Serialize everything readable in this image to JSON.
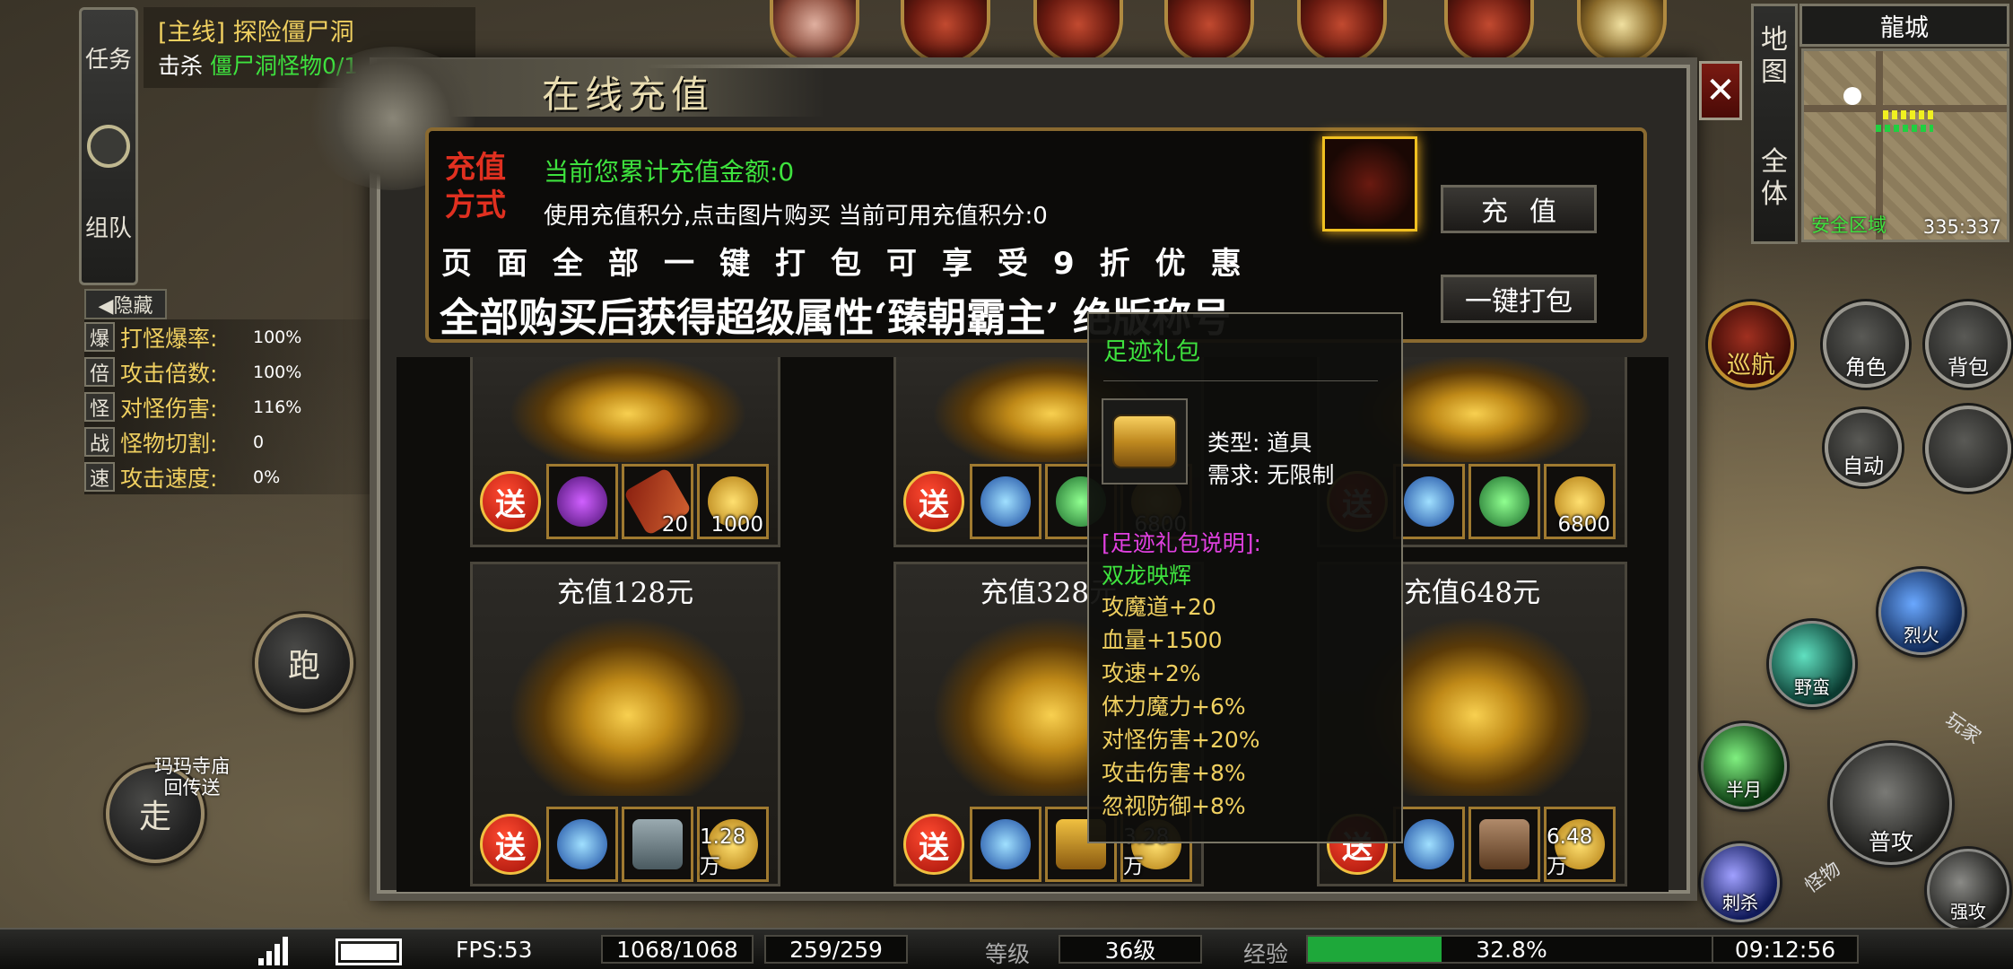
{
  "quest": {
    "tabs": [
      "任务",
      "组队"
    ],
    "title": "[主线] 探险僵尸洞",
    "desc_prefix": "击杀",
    "desc_target": "僵尸洞怪物0/1"
  },
  "hide_label": "◀隐藏",
  "stats": [
    {
      "tag": "爆",
      "name": "打怪爆率:",
      "value": "100%"
    },
    {
      "tag": "倍",
      "name": "攻击倍数:",
      "value": "100%"
    },
    {
      "tag": "怪",
      "name": "对怪伤害:",
      "value": "116%"
    },
    {
      "tag": "战",
      "name": "怪物切割:",
      "value": "0"
    },
    {
      "tag": "速",
      "name": "攻击速度:",
      "value": "0%"
    }
  ],
  "controls": {
    "run": "跑",
    "walk": "走",
    "portal": "玛玛寺庙\n回传送"
  },
  "map": {
    "tabs": [
      "地图",
      "全体"
    ],
    "name": "龍城",
    "zone": "安全区域",
    "coords": "335:337"
  },
  "side_buttons": {
    "patrol": "巡航",
    "character": "角色",
    "bag": "背包",
    "auto": "自动",
    "skill_fire": "烈火",
    "skill_savage": "野蛮",
    "skill_halfmoon": "半月",
    "attack": "普攻",
    "skill_assassin": "刺杀",
    "strong_attack": "强攻",
    "player_tag": "玩家",
    "monster_tag": "怪物"
  },
  "dialog": {
    "title": "在线充值",
    "pay_method": "充值\n方式",
    "total_label": "当前您累计充值金额:0",
    "points_label": "使用充值积分,点击图片购买 当前可用充值积分:0",
    "discount": "页面全部一键打包可享受9折优惠",
    "title_reward": "全部购买后获得超级属性‘臻朝霸主’ 绝版称号",
    "recharge_btn": "充值",
    "pack_btn": "一键打包"
  },
  "packs_top": [
    {
      "counts": [
        "",
        "20",
        "1000"
      ]
    },
    {
      "counts": [
        "",
        "",
        "6800"
      ]
    },
    {
      "counts": [
        "",
        "",
        "6800"
      ]
    }
  ],
  "packs_bottom": [
    {
      "title": "充值128元",
      "counts": [
        "",
        "",
        "1.28万"
      ]
    },
    {
      "title": "充值328元",
      "counts": [
        "",
        "",
        "3.28万"
      ]
    },
    {
      "title": "充值648元",
      "counts": [
        "",
        "",
        "6.48万"
      ]
    }
  ],
  "gift_label": "送",
  "tooltip": {
    "name": "足迹礼包",
    "type": "类型: 道具",
    "require": "需求: 无限制",
    "desc_head": "[足迹礼包说明]:",
    "set_name": "双龙映辉",
    "attrs": [
      "攻魔道+20",
      "血量+1500",
      "攻速+2%",
      "体力魔力+6%",
      "对怪伤害+20%",
      "攻击伤害+8%",
      "忽视防御+8%"
    ]
  },
  "statusbar": {
    "fps": "FPS:53",
    "hp": "1068/1068",
    "mp": "259/259",
    "level_label": "等级",
    "level": "36级",
    "exp_label": "经验",
    "exp_pct": "32.8%",
    "exp_fraction": 0.328,
    "time": "09:12:56"
  }
}
